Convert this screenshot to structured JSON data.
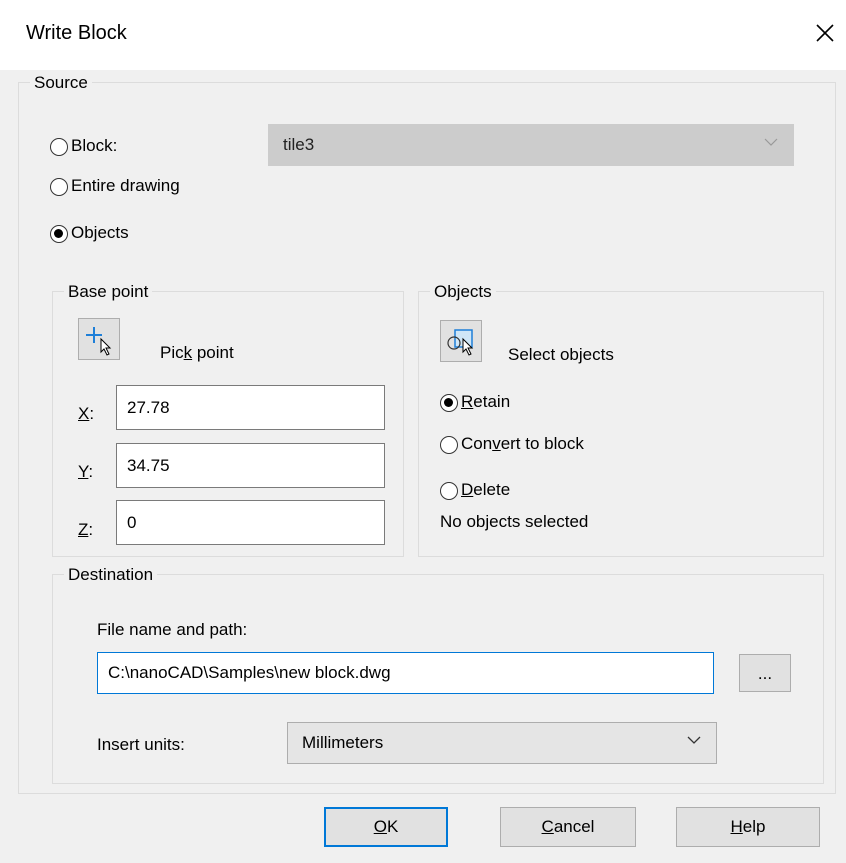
{
  "window": {
    "title": "Write Block",
    "close_icon": "close-icon"
  },
  "source": {
    "legend": "Source",
    "block_option": "Block:",
    "block_value": "tile3",
    "entire_drawing_option": "Entire drawing",
    "objects_option": "Objects",
    "selected_option": "Objects"
  },
  "base_point": {
    "legend": "Base point",
    "pick_label_pre": "Pic",
    "pick_label_key": "k",
    "pick_label_post": " point",
    "x_label": "X",
    "y_label": "Y",
    "z_label": "Z",
    "x_value": "27.78",
    "y_value": "34.75",
    "z_value": "0"
  },
  "objects": {
    "legend": "Objects",
    "select_label": "Select objects",
    "retain_key": "R",
    "retain_rest": "etain",
    "convert_pre": "Con",
    "convert_key": "v",
    "convert_post": "ert to block",
    "delete_key": "D",
    "delete_rest": "elete",
    "selected_option": "Retain",
    "status": "No objects selected"
  },
  "destination": {
    "legend": "Destination",
    "file_label": "File name and path:",
    "file_value": "C:\\nanoCAD\\Samples\\new block.dwg",
    "browse_label": "...",
    "units_label": "Insert units:",
    "units_value": "Millimeters"
  },
  "buttons": {
    "ok_key": "O",
    "ok_rest": "K",
    "cancel_key": "C",
    "cancel_rest": "ancel",
    "help_key": "H",
    "help_rest": "elp"
  }
}
